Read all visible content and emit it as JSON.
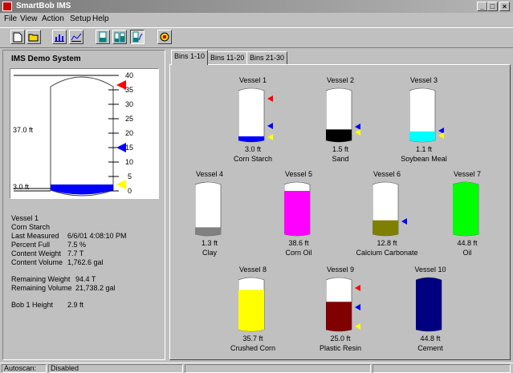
{
  "window": {
    "title": "SmartBob IMS",
    "controls": {
      "minimize": "_",
      "maximize": "□",
      "close": "×"
    }
  },
  "menu": [
    "File",
    "View",
    "Action",
    "Setup",
    "Help"
  ],
  "toolbar": {
    "buttons": [
      "new-icon",
      "open-icon",
      "bar-chart-icon",
      "line-chart-icon",
      "vessel-icon",
      "vessel-group-icon",
      "vessel-graph-icon",
      "measure-icon"
    ]
  },
  "left_panel": {
    "system_name": "IMS Demo System",
    "scale_ticks": [
      "40",
      "35",
      "30",
      "25",
      "20",
      "15",
      "10",
      "5",
      "0"
    ],
    "headroom_label": "37.0 ft",
    "level_label": "3.0 ft",
    "info": {
      "vessel": "Vessel 1",
      "material": "Corn Starch",
      "rows": [
        {
          "label": "Last Measured",
          "value": "6/6/01 4:08:10 PM"
        },
        {
          "label": "Percent Full",
          "value": "7.5 %"
        },
        {
          "label": "Content Weight",
          "value": "7.7 T"
        },
        {
          "label": "Content Volume",
          "value": "1,762.6 gal"
        },
        {
          "label": "Remaining Weight",
          "value": "94.4 T"
        },
        {
          "label": "Remaining Volume",
          "value": "21,738.2 gal"
        },
        {
          "label": "Bob 1 Height",
          "value": "2.9 ft"
        }
      ]
    }
  },
  "tabs": [
    "Bins 1-10",
    "Bins 11-20",
    "Bins 21-30"
  ],
  "active_tab": "Bins 1-10",
  "vessels": [
    {
      "name": "Vessel 1",
      "height": "3.0 ft",
      "material": "Corn Starch",
      "fill": 0.08,
      "color": "#0000ff"
    },
    {
      "name": "Vessel 2",
      "height": "1.5 ft",
      "material": "Sand",
      "fill": 0.22,
      "color": "#000000"
    },
    {
      "name": "Vessel 3",
      "height": "1.1 ft",
      "material": "Soybean Meal",
      "fill": 0.18,
      "color": "#00ffff"
    },
    {
      "name": "Vessel 4",
      "height": "1.3 ft",
      "material": "Clay",
      "fill": 0.14,
      "color": "#808080"
    },
    {
      "name": "Vessel 5",
      "height": "38.6 ft",
      "material": "Corn Oil",
      "fill": 0.87,
      "color": "#ff00ff"
    },
    {
      "name": "Vessel 6",
      "height": "12.8 ft",
      "material": "Calcium Carbonate",
      "fill": 0.28,
      "color": "#808000"
    },
    {
      "name": "Vessel 7",
      "height": "44.8 ft",
      "material": "Oil",
      "fill": 1.0,
      "color": "#00ff00"
    },
    {
      "name": "Vessel 8",
      "height": "35.7 ft",
      "material": "Crushed Corn",
      "fill": 0.8,
      "color": "#ffff00"
    },
    {
      "name": "Vessel 9",
      "height": "25.0 ft",
      "material": "Plastic Resin",
      "fill": 0.56,
      "color": "#800000"
    },
    {
      "name": "Vessel 10",
      "height": "44.8 ft",
      "material": "Cement",
      "fill": 1.0,
      "color": "#000080"
    }
  ],
  "statusbar": {
    "autoscan_label": "Autoscan:",
    "autoscan_value": "Disabled"
  }
}
